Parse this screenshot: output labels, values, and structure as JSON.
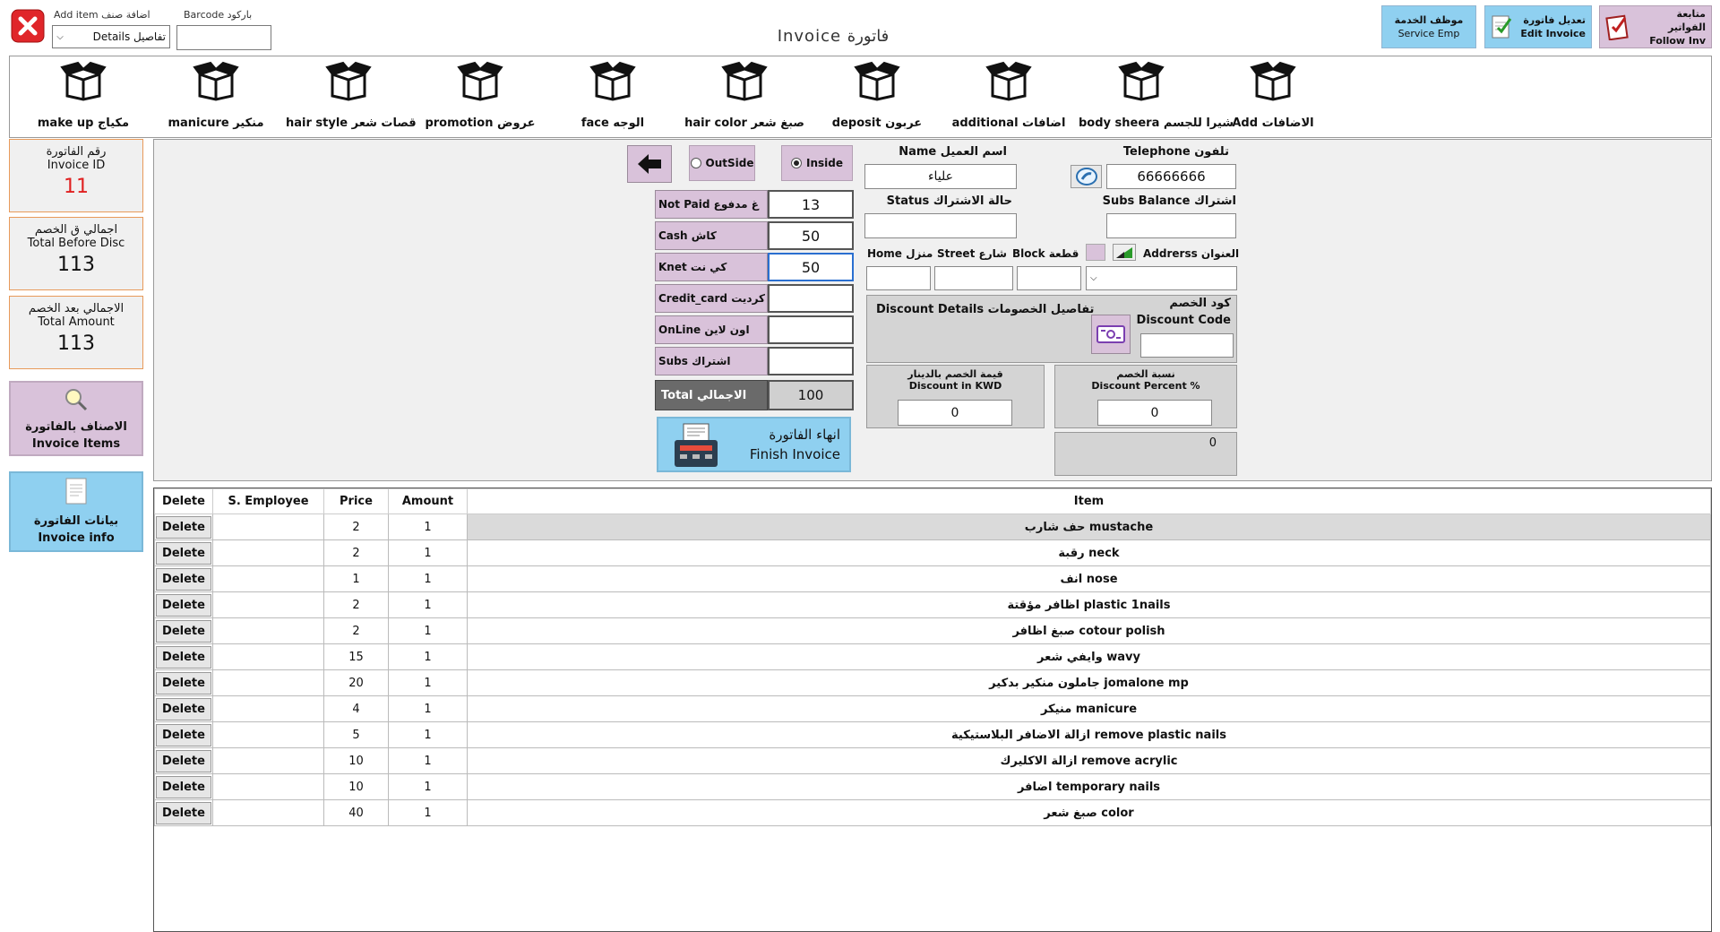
{
  "header": {
    "add_item_label": "Add item اضافة صنف",
    "barcode_label": "Barcode باركود",
    "details_combo_value": "Details تفاصيل",
    "barcode_value": "",
    "title": "Invoice فاتورة",
    "buttons": {
      "service_emp": [
        "موظف الخدمة",
        "Service Emp"
      ],
      "edit_invoice": [
        "تعديل فاتورة",
        "Edit Invoice"
      ],
      "follow_inv": [
        "متابعة الفواتير",
        "Follow Inv"
      ]
    }
  },
  "categories": [
    "Add الاضافات",
    "body sheera شيرا للجسم",
    "additional اضافات",
    "deposit عربون",
    "hair color صبغ شعر",
    "face الوجه",
    "promotion عروض",
    "hair style قصات شعر",
    "manicure منكير",
    "make up مكياج"
  ],
  "left_panel": {
    "invoice_id": {
      "ar": "رقم الفاتورة",
      "en": "Invoice ID",
      "value": "11"
    },
    "total_before_disc": {
      "ar": "اجمالي ق الخصم",
      "en": "Total Before Disc",
      "value": "113"
    },
    "total_amount": {
      "ar": "الاجمالي بعد الخصم",
      "en": "Total Amount",
      "value": "113"
    },
    "invoice_items_btn": {
      "ar": "الاصناف بالفاتورة",
      "en": "Invoice Items"
    },
    "invoice_info_btn": {
      "ar": "بيانات الفاتورة",
      "en": "Invoice info"
    }
  },
  "payment": {
    "outside_label": "OutSide",
    "inside_label": "Inside",
    "selected": "Inside",
    "rows": [
      {
        "label": "Not Paid غ مدفوع",
        "value": "13"
      },
      {
        "label": "Cash كاش",
        "value": "50"
      },
      {
        "label": "Knet كي نت",
        "value": "50"
      },
      {
        "label": "Credit_card كرديت",
        "value": ""
      },
      {
        "label": "OnLine اون لاين",
        "value": ""
      },
      {
        "label": "Subs اشتراك",
        "value": ""
      }
    ],
    "total_label": "Total الاجمالي",
    "total_value": "100",
    "finish_btn": {
      "ar": "انهاء الفاتورة",
      "en": "Finish Invoice"
    }
  },
  "customer": {
    "name_label": "Name اسم العميل",
    "name_value": "علياء",
    "telephone_label": "Telephone تلفون",
    "telephone_value": "66666666",
    "status_label": "Status حالة الاشتراك",
    "status_value": "",
    "subs_balance_label": "Subs Balance اشتراك",
    "subs_balance_value": "",
    "home_label": "Home منزل",
    "street_label": "Street شارع",
    "block_label": "Block قطعة",
    "address_label": "Addrerss العنوان",
    "home_value": "",
    "street_value": "",
    "block_value": "",
    "address_value": ""
  },
  "discount": {
    "details_label": "Discount Details تفاصيل الخصومات",
    "code_label_ar": "كود الخصم",
    "code_label_en": "Discount Code",
    "code_value": "",
    "kwd_label_ar": "قيمة الخصم بالدينار",
    "kwd_label_en": "Discount in KWD",
    "kwd_value": "0",
    "percent_label_ar": "نسبة الخصم",
    "percent_label_en": "Discount Percent %",
    "percent_value": "0",
    "extra_value": "0"
  },
  "table": {
    "columns": [
      "Delete",
      "S. Employee",
      "Price",
      "Amount",
      "Item"
    ],
    "delete_label": "Delete",
    "rows": [
      {
        "employee": "",
        "price": "2",
        "amount": "1",
        "item": "حف شارب mustache"
      },
      {
        "employee": "",
        "price": "2",
        "amount": "1",
        "item": "رقبة neck"
      },
      {
        "employee": "",
        "price": "1",
        "amount": "1",
        "item": "انف nose"
      },
      {
        "employee": "",
        "price": "2",
        "amount": "1",
        "item": "اظافر مؤقتة plastic 1nails"
      },
      {
        "employee": "",
        "price": "2",
        "amount": "1",
        "item": "صبغ اظافر cotour polish"
      },
      {
        "employee": "",
        "price": "15",
        "amount": "1",
        "item": "وايفي شعر wavy"
      },
      {
        "employee": "",
        "price": "20",
        "amount": "1",
        "item": "جاملون منكير بدكير jomalone mp"
      },
      {
        "employee": "",
        "price": "4",
        "amount": "1",
        "item": "منيكر manicure"
      },
      {
        "employee": "",
        "price": "5",
        "amount": "1",
        "item": "ازالة الاضافر البلاستيكية remove plastic nails"
      },
      {
        "employee": "",
        "price": "10",
        "amount": "1",
        "item": "ازالة الاكليرك remove acrylic"
      },
      {
        "employee": "",
        "price": "10",
        "amount": "1",
        "item": "اضافر temporary nails"
      },
      {
        "employee": "",
        "price": "40",
        "amount": "1",
        "item": "صبغ شعر color"
      }
    ]
  },
  "colors": {
    "accent_blue": "#8fd0f0",
    "purple_label": "#d9c2da",
    "invoice_id_red": "#e02020",
    "close_red": "#e0262a"
  }
}
